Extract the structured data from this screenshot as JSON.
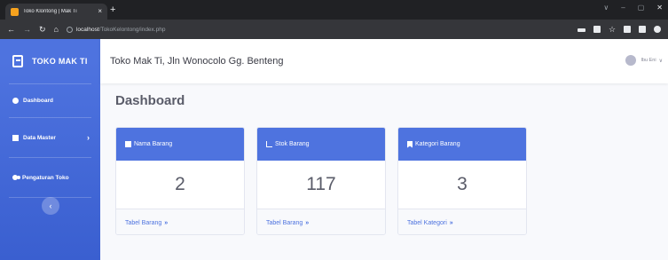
{
  "browser": {
    "tab_title": "Toko Klontong | Mak Ti",
    "tab_close": "×",
    "new_tab": "+",
    "url_host": "localhost",
    "url_path": "/TokoKelontong/index.php"
  },
  "sidebar": {
    "brand": "TOKO MAK TI",
    "items": [
      {
        "label": "Dashboard",
        "icon": "dashboard-icon"
      },
      {
        "label": "Data Master",
        "icon": "book-icon",
        "chevron": "›"
      },
      {
        "label": "Pengaturan Toko",
        "icon": "cogs-icon"
      }
    ],
    "toggle": "‹"
  },
  "topbar": {
    "title": "Toko Mak Ti, Jln Wonocolo Gg. Benteng",
    "username": "Ibu Eni",
    "chevron": "∨"
  },
  "main": {
    "page_title": "Dashboard",
    "cards": [
      {
        "header": "Nama Barang",
        "icon": "cubes-icon",
        "value": "2",
        "footer": "Tabel Barang",
        "arrows": "»"
      },
      {
        "header": "Stok Barang",
        "icon": "chart-icon",
        "value": "117",
        "footer": "Tabel Barang",
        "arrows": "»"
      },
      {
        "header": "Kategori Barang",
        "icon": "bookmark-icon",
        "value": "3",
        "footer": "Tabel Kategori",
        "arrows": "»"
      }
    ]
  },
  "colors": {
    "primary": "#4e73df",
    "text": "#5a5c69",
    "chrome": "#202124"
  }
}
